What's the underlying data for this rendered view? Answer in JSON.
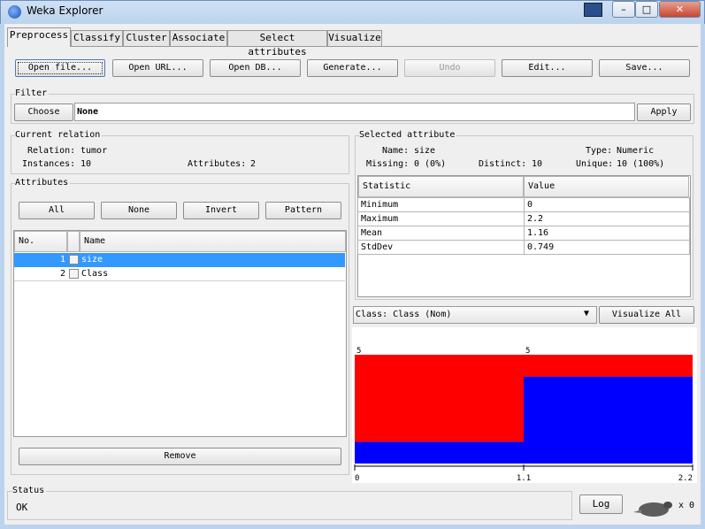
{
  "window": {
    "title": "Weka Explorer"
  },
  "tabs": [
    {
      "label": "Preprocess"
    },
    {
      "label": "Classify"
    },
    {
      "label": "Cluster"
    },
    {
      "label": "Associate"
    },
    {
      "label": "Select attributes"
    },
    {
      "label": "Visualize"
    }
  ],
  "toolbar": {
    "open_file": "Open file...",
    "open_url": "Open URL...",
    "open_db": "Open DB...",
    "generate": "Generate...",
    "undo": "Undo",
    "edit": "Edit...",
    "save": "Save..."
  },
  "filter": {
    "title": "Filter",
    "choose": "Choose",
    "value": "None",
    "apply": "Apply"
  },
  "current_relation": {
    "title": "Current relation",
    "relation_label": "Relation:",
    "relation_value": "tumor",
    "instances_label": "Instances:",
    "instances_value": "10",
    "attributes_label": "Attributes:",
    "attributes_value": "2"
  },
  "attributes": {
    "title": "Attributes",
    "buttons": {
      "all": "All",
      "none": "None",
      "invert": "Invert",
      "pattern": "Pattern"
    },
    "columns": {
      "no": "No.",
      "name": "Name"
    },
    "rows": [
      {
        "no": "1",
        "name": "size",
        "selected": true
      },
      {
        "no": "2",
        "name": "Class",
        "selected": false
      }
    ],
    "remove": "Remove"
  },
  "selected_attribute": {
    "title": "Selected attribute",
    "name_label": "Name:",
    "name_value": "size",
    "type_label": "Type:",
    "type_value": "Numeric",
    "missing_label": "Missing:",
    "missing_value": "0 (0%)",
    "distinct_label": "Distinct:",
    "distinct_value": "10",
    "unique_label": "Unique:",
    "unique_value": "10 (100%)",
    "table": {
      "headers": {
        "statistic": "Statistic",
        "value": "Value"
      },
      "rows": [
        {
          "statistic": "Minimum",
          "value": "0"
        },
        {
          "statistic": "Maximum",
          "value": "2.2"
        },
        {
          "statistic": "Mean",
          "value": "1.16"
        },
        {
          "statistic": "StdDev",
          "value": "0.749"
        }
      ]
    }
  },
  "class_select": {
    "value": "Class: Class (Nom)",
    "visualize_all": "Visualize All"
  },
  "histogram": {
    "x_labels": [
      "0",
      "1.1",
      "2.2"
    ],
    "bins": [
      {
        "total": 5,
        "blue": 1,
        "red": 4
      },
      {
        "total": 5,
        "blue": 4,
        "red": 1
      }
    ],
    "count_labels": [
      "5",
      "5"
    ],
    "colors": {
      "red": "#ff0000",
      "blue": "#0000ff"
    }
  },
  "status": {
    "title": "Status",
    "message": "OK",
    "log": "Log",
    "task_count": "x 0"
  }
}
